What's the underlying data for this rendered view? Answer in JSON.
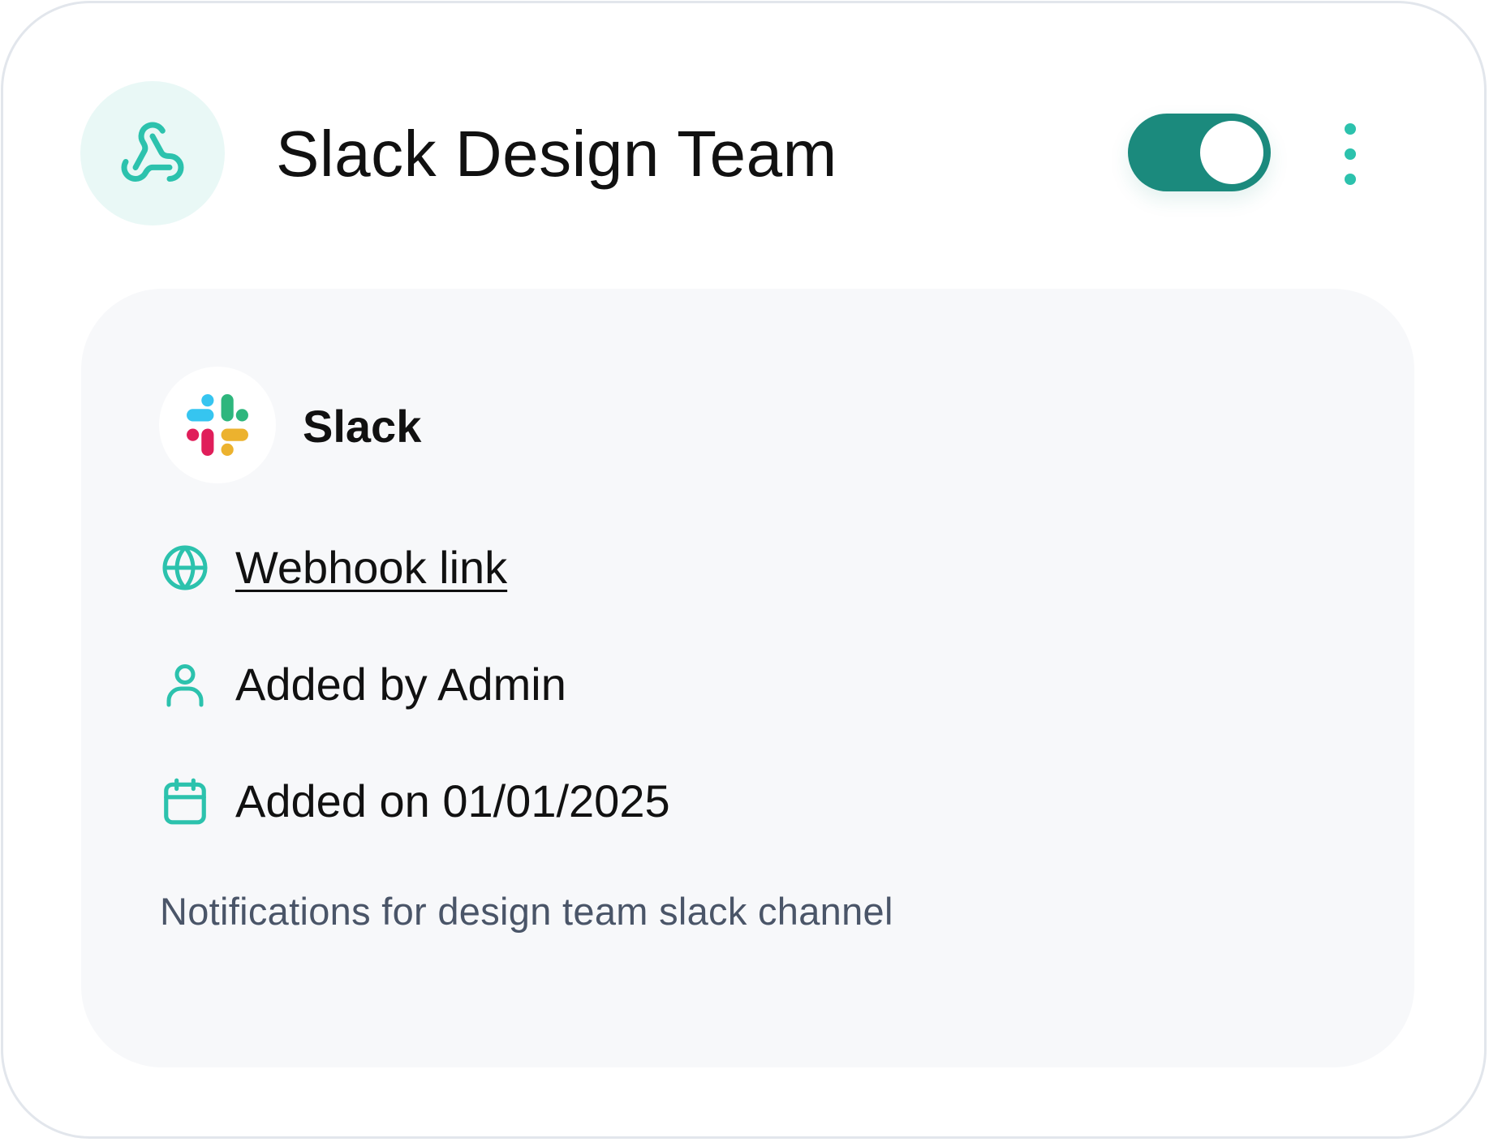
{
  "header": {
    "icon": "webhook-icon",
    "title": "Slack Design Team",
    "toggle_on": true,
    "menu_icon": "kebab-menu-icon"
  },
  "provider": {
    "logo": "slack-logo",
    "name": "Slack"
  },
  "details": {
    "webhook": {
      "icon": "globe-icon",
      "label": "Webhook link"
    },
    "added_by": {
      "icon": "user-icon",
      "label": "Added by Admin"
    },
    "added_on": {
      "icon": "calendar-icon",
      "label": "Added on 01/01/2025"
    }
  },
  "description": "Notifications for design team slack channel",
  "colors": {
    "accent": "#2cc2ad",
    "toggle_bg": "#1b8a7d",
    "icon_circle_bg": "#e9f8f6",
    "panel_bg": "#f7f8fa",
    "description_text": "#4a5568",
    "slack_blue": "#36c5f0",
    "slack_green": "#2eb67d",
    "slack_yellow": "#ecb22e",
    "slack_red": "#e01e5a"
  }
}
